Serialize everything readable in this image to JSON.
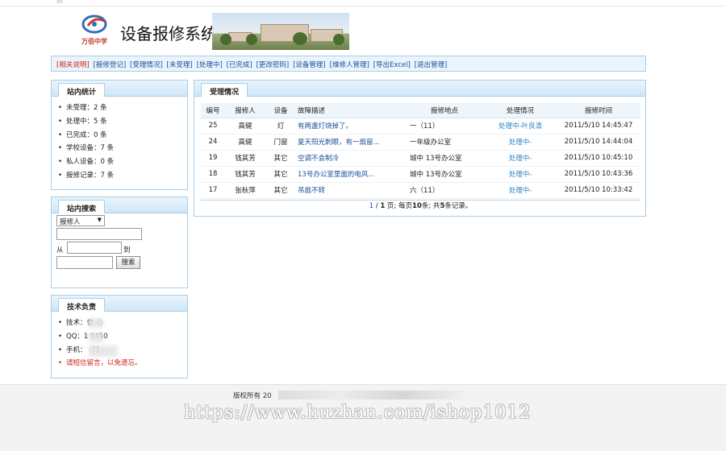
{
  "header": {
    "logo_text": "万佰中学",
    "title": "设备报修系统"
  },
  "nav": {
    "items": [
      {
        "label": "[相关说明]",
        "active": true
      },
      {
        "label": "[报修登记]"
      },
      {
        "label": "[受理情况]"
      },
      {
        "label": "[未受理]"
      },
      {
        "label": "[处理中]"
      },
      {
        "label": "[已完成]"
      },
      {
        "label": "[更改密码]"
      },
      {
        "label": "[设备管理]"
      },
      {
        "label": "[维修人管理]"
      },
      {
        "label": "[导出Excel]"
      },
      {
        "label": "[退出管理]"
      }
    ]
  },
  "stats_panel": {
    "title": "站内统计",
    "items": [
      "未受理：2 条",
      "处理中：5 条",
      "已完成：0 条",
      "学校设备：7 条",
      "私人设备：0 条",
      "报修记录：7 条"
    ]
  },
  "search_panel": {
    "title": "站内搜索",
    "select_value": "报修人",
    "from_label": "从",
    "to_label": "到",
    "search_button": "搜索"
  },
  "tech_panel": {
    "title": "技术负责",
    "items": [
      {
        "text": "技术：信 心"
      },
      {
        "text": "QQ：1 0450"
      },
      {
        "text": "手机： :71"
      },
      {
        "text": "请短信留言，以免遗忘。",
        "warn": true
      }
    ]
  },
  "main_panel": {
    "title": "受理情况",
    "columns": [
      "编号",
      "报修人",
      "设备",
      "故障描述",
      "报修地点",
      "处理情况",
      "报修时间"
    ],
    "rows": [
      {
        "id": "25",
        "reporter": "高健",
        "device": "灯",
        "desc": "有两盏灯烧掉了。",
        "location": "一（11）",
        "status": "处理中-叶良清",
        "time": "2011/5/10 14:45:47"
      },
      {
        "id": "24",
        "reporter": "高健",
        "device": "门窗",
        "desc": "夏天阳光刺眼，有一扇窗...",
        "location": "一年级办公室",
        "status": "处理中-",
        "time": "2011/5/10 14:44:04"
      },
      {
        "id": "19",
        "reporter": "钱其芳",
        "device": "其它",
        "desc": "空调不会制冷",
        "location": "城中 13号办公室",
        "status": "处理中-",
        "time": "2011/5/10 10:45:10"
      },
      {
        "id": "18",
        "reporter": "钱其芳",
        "device": "其它",
        "desc": "13号办公室里面的电风...",
        "location": "城中 13号办公室",
        "status": "处理中-",
        "time": "2011/5/10 10:43:36"
      },
      {
        "id": "17",
        "reporter": "张秋萍",
        "device": "其它",
        "desc": "吊扇不转",
        "location": "六（11）",
        "status": "处理中-",
        "time": "2011/5/10 10:33:42"
      }
    ],
    "pager": {
      "current": "1",
      "sep": " / ",
      "total": "1",
      "text1": " 页; 每页",
      "per_page": "10",
      "text2": "条; 共",
      "count": "5",
      "text3": "条记录。"
    }
  },
  "footer": {
    "copyright": "版权所有 20",
    "watermark": "https://www.huzhan.com/ishop1012"
  }
}
